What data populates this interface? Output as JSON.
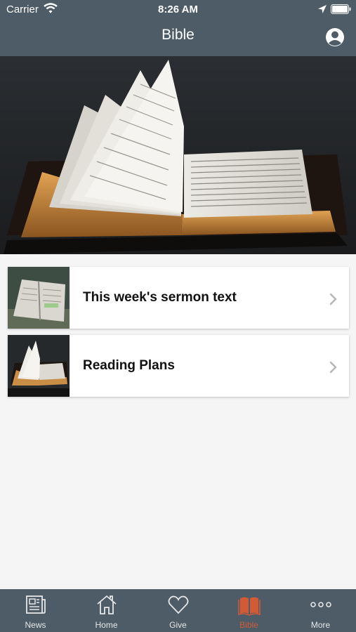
{
  "status_bar": {
    "carrier": "Carrier",
    "time": "8:26 AM"
  },
  "header": {
    "title": "Bible"
  },
  "hero": {
    "alt": "Open Bible with turning pages"
  },
  "cards": [
    {
      "label": "This week's sermon text"
    },
    {
      "label": "Reading Plans"
    }
  ],
  "tabbar": {
    "active": "Bible",
    "active_color": "#d35a37",
    "tabs": [
      {
        "label": "News",
        "icon": "newspaper-icon"
      },
      {
        "label": "Home",
        "icon": "house-icon"
      },
      {
        "label": "Give",
        "icon": "heart-icon"
      },
      {
        "label": "Bible",
        "icon": "open-book-icon"
      },
      {
        "label": "More",
        "icon": "ellipsis-icon"
      }
    ]
  },
  "colors": {
    "bar_background": "#4d5c66",
    "page_background": "#f5f5f5"
  }
}
